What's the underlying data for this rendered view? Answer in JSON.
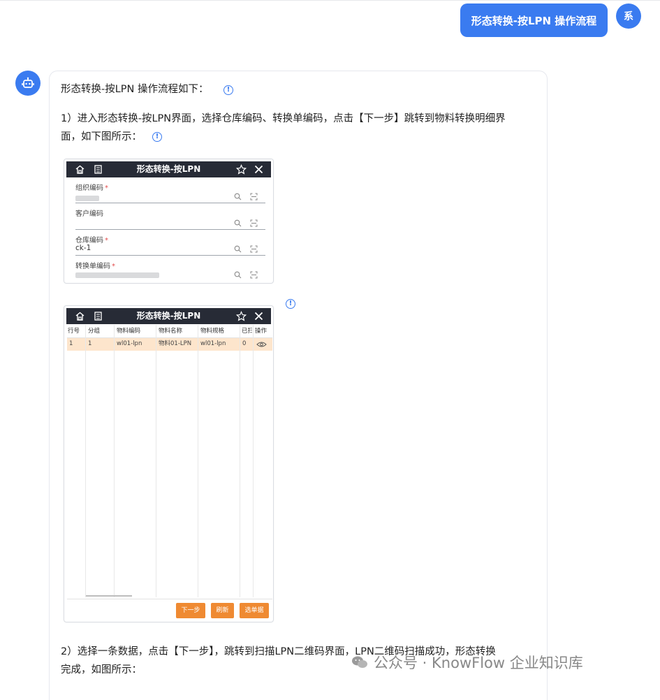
{
  "user_message": {
    "text": "形态转换-按LPN 操作流程",
    "avatar_label": "系"
  },
  "bot": {
    "intro": "形态转换-按LPN 操作流程如下：",
    "step1_line1": "1）进入形态转换-按LPN界面，选择仓库编码、转换单编码，点击【下一步】跳转到物料转换明细界",
    "step1_line2": "面，如下图所示：",
    "step2_line1": "2）选择一条数据，点击【下一步】，跳转到扫描LPN二维码界面，LPN二维码扫描成功，形态转换",
    "step2_line2": "完成，如图所示："
  },
  "screenshot1": {
    "title": "形态转换-按LPN",
    "fields": [
      {
        "label": "组织编码",
        "required": true,
        "value": ""
      },
      {
        "label": "客户编码",
        "required": false,
        "value": ""
      },
      {
        "label": "仓库编码",
        "required": true,
        "value": "ck-1"
      },
      {
        "label": "转换单编码",
        "required": true,
        "value": ""
      }
    ]
  },
  "screenshot2": {
    "title": "形态转换-按LPN",
    "columns": [
      "行号",
      "分组",
      "物料编码",
      "物料名称",
      "物料规格",
      "已扫",
      "操作"
    ],
    "rows": [
      [
        "1",
        "1",
        "wl01-lpn",
        "物料01-LPN",
        "wl01-lpn",
        "0",
        ""
      ]
    ],
    "buttons": [
      "下一步",
      "刷新",
      "选单据"
    ],
    "button_color": "#ef8a32"
  },
  "watermark": "公众号 · KnowFlow 企业知识库",
  "colors": {
    "accent": "#3a7bf0",
    "header_dark": "#272b36",
    "row_highlight": "#fde5cc"
  }
}
